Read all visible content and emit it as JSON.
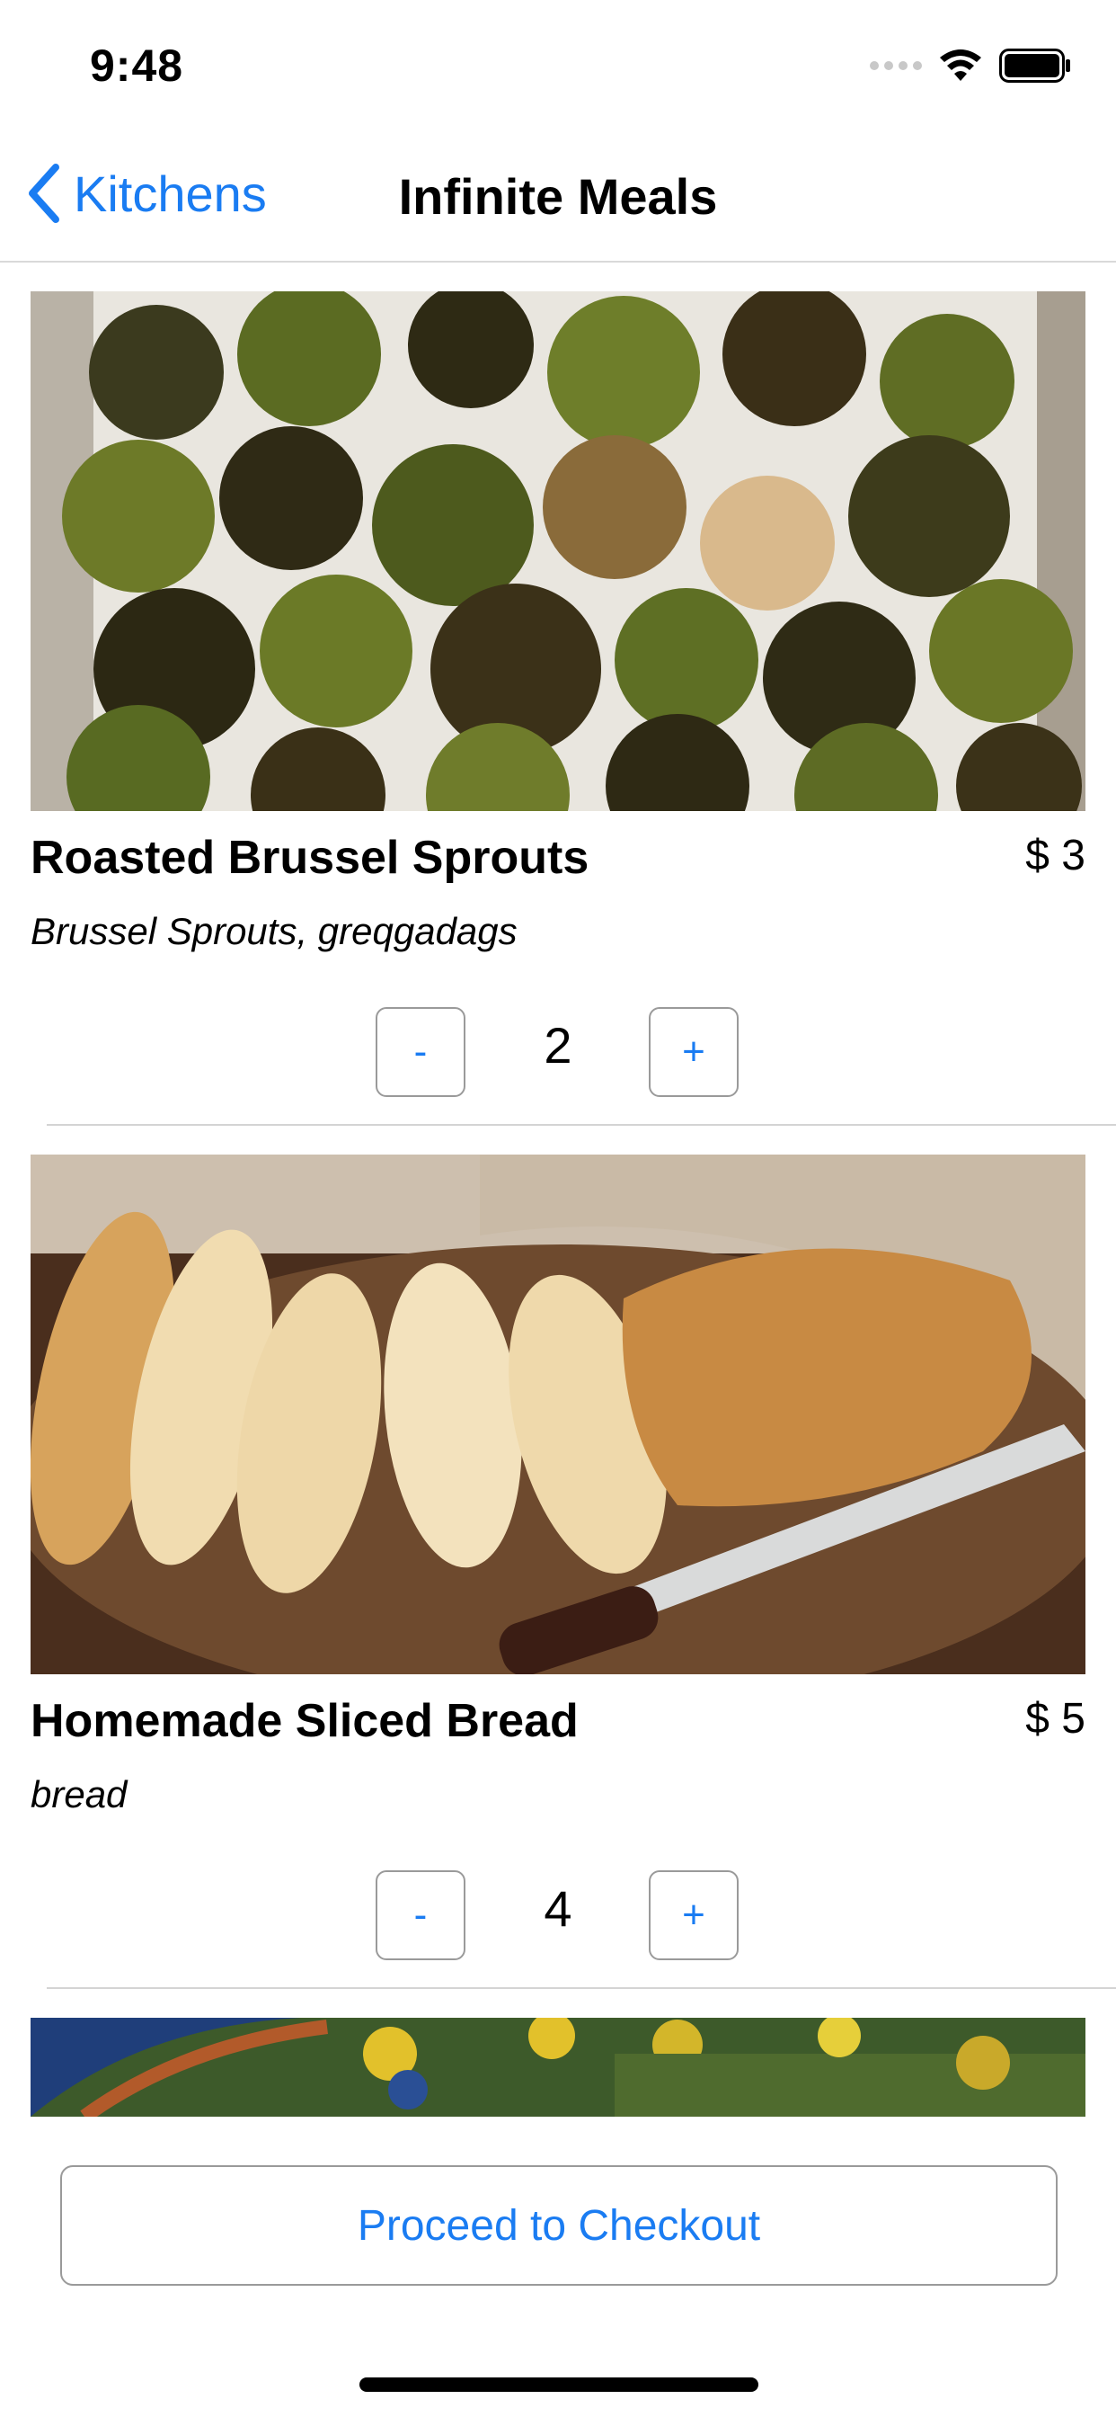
{
  "status_bar": {
    "time": "9:48",
    "icons": [
      "signal-icon",
      "wifi-icon",
      "battery-icon"
    ]
  },
  "nav": {
    "back_label": "Kitchens",
    "back_icon": "chevron-left-icon",
    "title": "Infinite Meals"
  },
  "accent_color": "#1a7cf2",
  "menu_items": [
    {
      "name": "Roasted Brussel Sprouts",
      "price": "$ 3",
      "ingredients": "Brussel Sprouts, greqgadags",
      "quantity": "2",
      "minus_label": "-",
      "plus_label": "+",
      "image": "roasted-brussel-sprouts-photo"
    },
    {
      "name": "Homemade Sliced Bread",
      "price": "$ 5",
      "ingredients": "bread",
      "quantity": "4",
      "minus_label": "-",
      "plus_label": "+",
      "image": "sliced-bread-photo"
    }
  ],
  "checkout": {
    "label": "Proceed to Checkout"
  }
}
